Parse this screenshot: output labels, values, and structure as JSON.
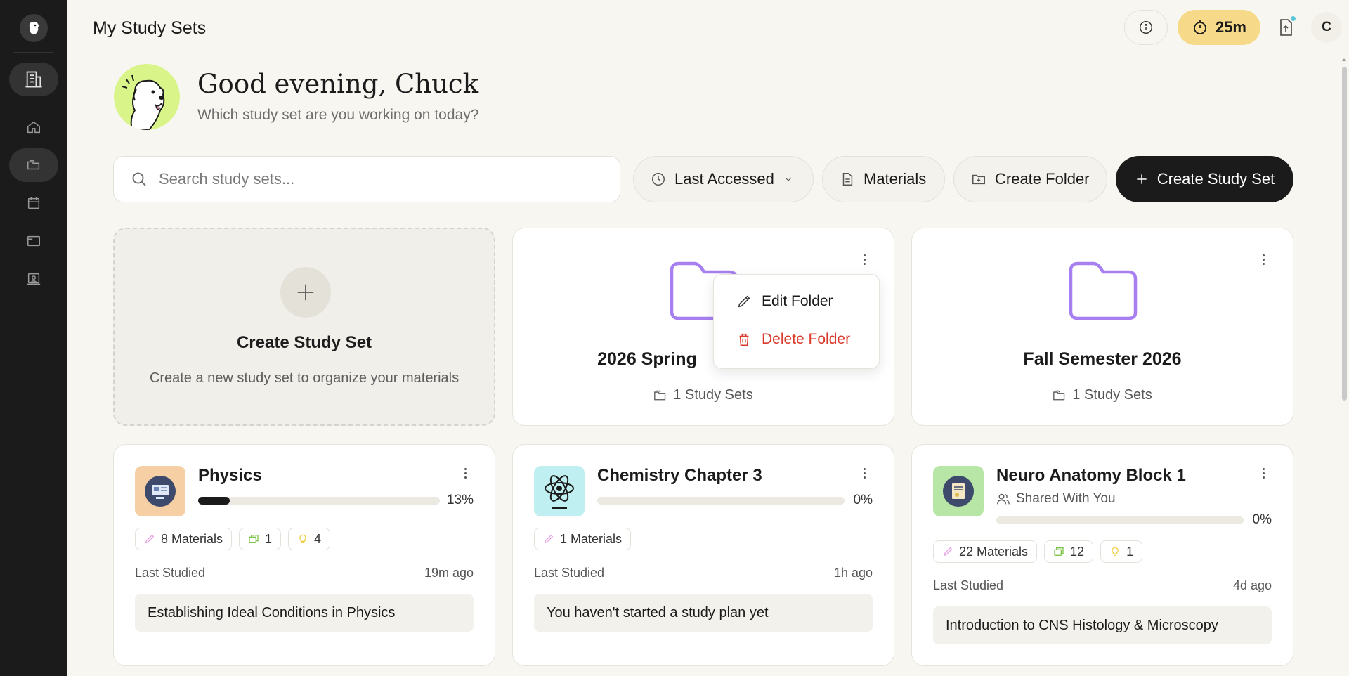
{
  "app": {
    "page_title": "My Study Sets"
  },
  "sidebar": {
    "items": [
      {
        "icon": "building-icon",
        "active": true
      },
      {
        "icon": "home-icon",
        "active": false
      },
      {
        "icon": "folders-icon",
        "active": true
      },
      {
        "icon": "calendar-icon",
        "active": false
      },
      {
        "icon": "window-icon",
        "active": false
      },
      {
        "icon": "classroom-icon",
        "active": false
      }
    ]
  },
  "header": {
    "timer_label": "25m",
    "avatar_initial": "C",
    "colors": {
      "timer_bg": "#f7d98a",
      "notify_dot": "#5cc7d6"
    }
  },
  "greeting": {
    "title": "Good evening, Chuck",
    "subtitle": "Which study set are you working on today?"
  },
  "controls": {
    "search_placeholder": "Search study sets...",
    "sort_label": "Last Accessed",
    "materials_label": "Materials",
    "create_folder_label": "Create Folder",
    "create_study_set_label": "Create Study Set"
  },
  "create_card": {
    "title": "Create Study Set",
    "subtitle": "Create a new study set to organize your materials"
  },
  "folders": [
    {
      "name": "2026 Spring",
      "count": "1 Study Sets"
    },
    {
      "name": "Fall Semester 2026",
      "count": "1 Study Sets"
    }
  ],
  "context_menu": {
    "edit_label": "Edit Folder",
    "delete_label": "Delete Folder"
  },
  "study_sets": [
    {
      "title": "Physics",
      "progress": 13,
      "progress_label": "13%",
      "materials": "8 Materials",
      "flashcards": "1",
      "quizzes": "4",
      "last_studied_label": "Last Studied",
      "last_studied": "19m ago",
      "plan": "Establishing Ideal Conditions in Physics",
      "thumb_color": "#f7cfa5"
    },
    {
      "title": "Chemistry Chapter 3",
      "progress": 0,
      "progress_label": "0%",
      "materials": "1 Materials",
      "last_studied_label": "Last Studied",
      "last_studied": "1h ago",
      "plan": "You haven't started a study plan yet",
      "thumb_color": "#bfeff0"
    },
    {
      "title": "Neuro Anatomy Block 1",
      "shared": "Shared With You",
      "progress": 0,
      "progress_label": "0%",
      "materials": "22 Materials",
      "flashcards": "12",
      "quizzes": "1",
      "last_studied_label": "Last Studied",
      "last_studied": "4d ago",
      "plan": "Introduction to CNS Histology & Microscopy",
      "thumb_color": "#b8e6a6"
    }
  ]
}
